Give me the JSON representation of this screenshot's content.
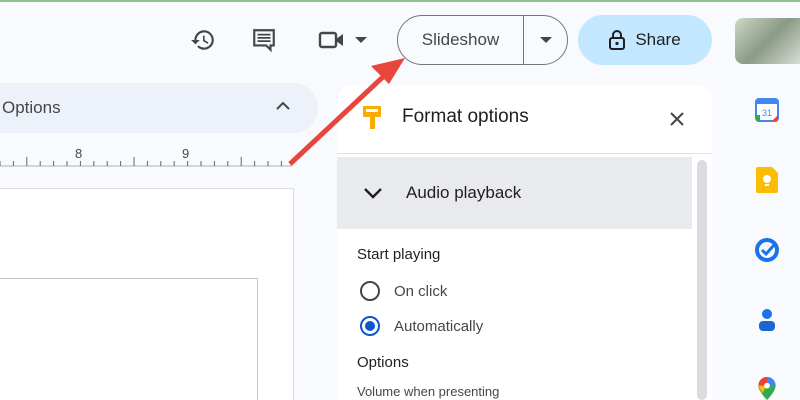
{
  "toolbar": {
    "slideshow_label": "Slideshow",
    "share_label": "Share"
  },
  "left": {
    "pill_label": "Options",
    "ruler_labels": [
      "8",
      "9"
    ]
  },
  "panel": {
    "title": "Format options",
    "section_title": "Audio playback",
    "start_playing_label": "Start playing",
    "options": [
      {
        "label": "On click",
        "selected": false
      },
      {
        "label": "Automatically",
        "selected": true
      }
    ],
    "options_heading": "Options",
    "volume_label": "Volume when presenting"
  },
  "colors": {
    "accent": "#0b57d0",
    "share_bg": "#c2e7ff",
    "arrow": "#e8453c"
  }
}
